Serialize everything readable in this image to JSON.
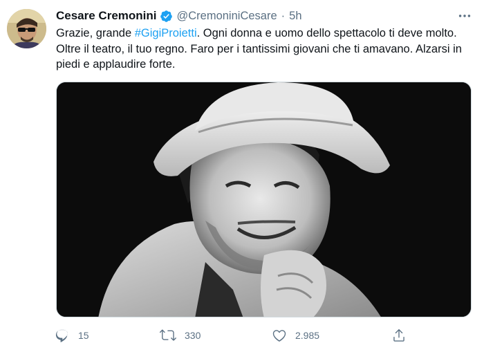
{
  "tweet": {
    "author_name": "Cesare Cremonini",
    "handle": "@CremoniniCesare",
    "separator": "·",
    "time": "5h",
    "text_before": "Grazie, grande ",
    "hashtag": "#GigiProietti",
    "text_after": ". Ogni donna e uomo dello spettacolo ti deve molto. Oltre il teatro, il tuo regno. Faro per i tantissimi giovani che ti amavano. Alzarsi in piedi e applaudire forte."
  },
  "actions": {
    "replies": "15",
    "retweets": "330",
    "likes": "2.985"
  },
  "icons": {
    "verified": "verified-badge-icon",
    "more": "more-options-icon",
    "reply": "reply-icon",
    "retweet": "retweet-icon",
    "like": "heart-icon",
    "share": "share-icon"
  },
  "colors": {
    "accent": "#1da1f2",
    "secondary_text": "#5b7083",
    "primary_text": "#0f1419"
  }
}
